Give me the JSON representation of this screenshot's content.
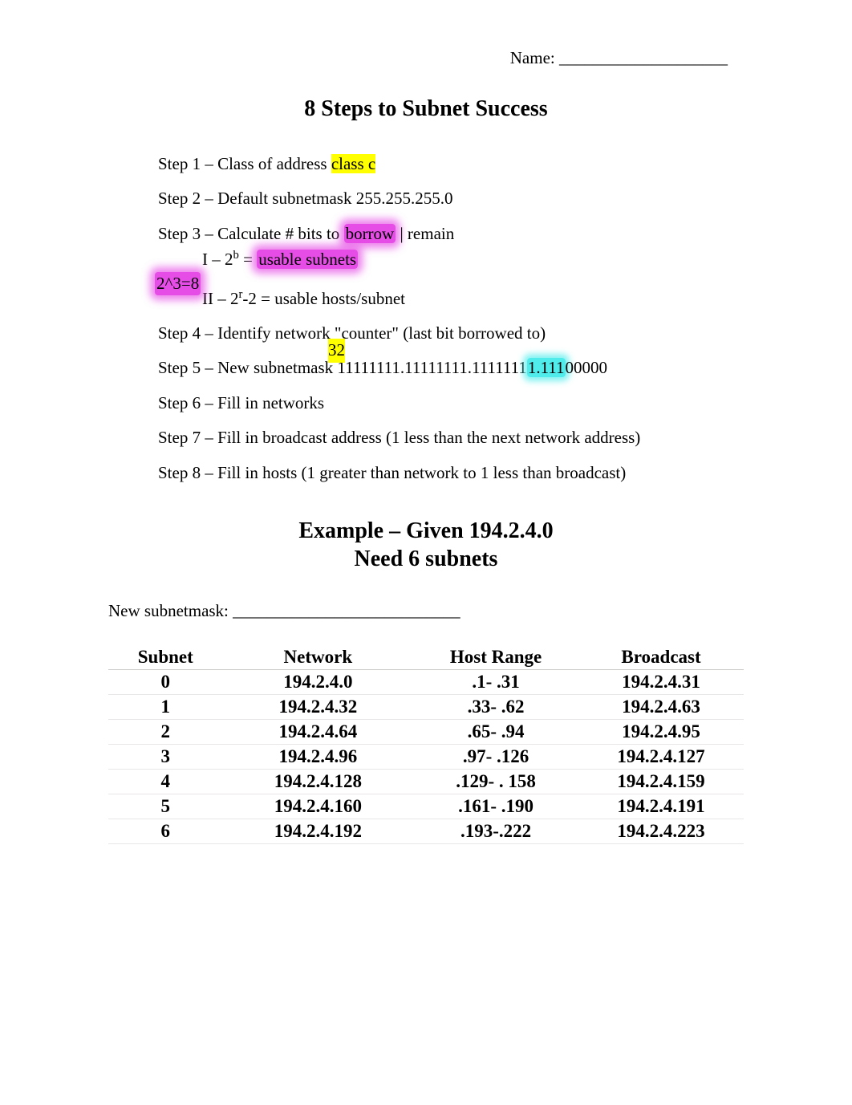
{
  "header": {
    "name_label": "Name: ____________________"
  },
  "title": "8 Steps to Subnet Success",
  "steps": {
    "s1_prefix": "Step 1 – Class of address ",
    "s1_hl": "class c",
    "s2": "Step 2 – Default subnetmask 255.255.255.0",
    "s3_prefix": "Step 3 – Calculate # bits to ",
    "s3_hl": "borrow",
    "s3_suffix": " | remain",
    "s3_i_prefix": "I – 2",
    "s3_i_sup": "b",
    "s3_i_mid": " = ",
    "s3_i_hl": "usable subnets",
    "s3_note": "2^3=8",
    "s3_ii_prefix": "II – 2",
    "s3_ii_sup": "r",
    "s3_ii_suffix": "-2 = usable hosts/subnet",
    "s4": "Step 4 – Identify network \"counter\" (last bit borrowed to)",
    "counter32": "32",
    "s5_prefix": "Step 5 – New subnetmask  11111111.11111111.1111111",
    "s5_hl": "1.111",
    "s5_suffix": "00000",
    "s6": "Step 6 – Fill in networks",
    "s7": "Step 7 – Fill in broadcast address (1 less than the next network address)",
    "s8": "Step 8 – Fill in hosts (1 greater than network to 1 less than broadcast)"
  },
  "example": {
    "title_line1": "Example – Given 194.2.4.0",
    "title_line2": "Need 6 subnets",
    "new_subnetmask": "New subnetmask: ___________________________"
  },
  "table": {
    "headers": [
      "Subnet",
      "Network",
      "Host Range",
      "Broadcast"
    ],
    "rows": [
      [
        "0",
        "194.2.4.0",
        ".1- .31",
        "194.2.4.31"
      ],
      [
        "1",
        "194.2.4.32",
        ".33- .62",
        "194.2.4.63"
      ],
      [
        "2",
        "194.2.4.64",
        ".65- .94",
        "194.2.4.95"
      ],
      [
        "3",
        "194.2.4.96",
        ".97- .126",
        "194.2.4.127"
      ],
      [
        "4",
        "194.2.4.128",
        ".129- . 158",
        "194.2.4.159"
      ],
      [
        "5",
        "194.2.4.160",
        ".161- .190",
        "194.2.4.191"
      ],
      [
        "6",
        "194.2.4.192",
        ".193-.222",
        "194.2.4.223"
      ]
    ]
  }
}
